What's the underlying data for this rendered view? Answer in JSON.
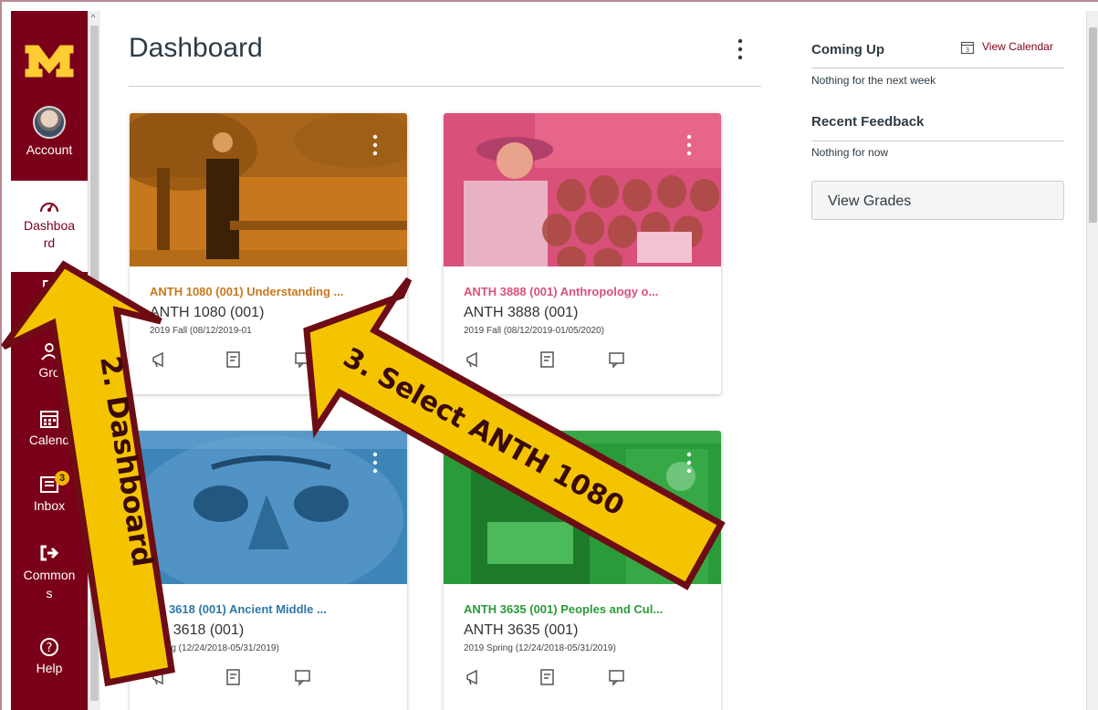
{
  "nav": {
    "account": "Account",
    "dashboard": "Dashboa rd",
    "groups": "Gro",
    "calendar": "Calend",
    "inbox": "Inbox",
    "inbox_badge": "3",
    "commons": "Common s",
    "help": "Help"
  },
  "page": {
    "title": "Dashboard"
  },
  "cards": [
    {
      "full_name": "ANTH 1080 (001) Understanding ...",
      "code": "ANTH 1080 (001)",
      "term": "2019 Fall (08/12/2019-01",
      "color": "#c8781c"
    },
    {
      "full_name": "ANTH 3888 (001) Anthropology o...",
      "code": "ANTH 3888 (001)",
      "term": "2019 Fall (08/12/2019-01/05/2020)",
      "color": "#d9517a"
    },
    {
      "full_name": "TH 3618 (001) Ancient Middle ...",
      "code": "TH 3618 (001)",
      "term": "Spring (12/24/2018-05/31/2019)",
      "color": "#2f77a6"
    },
    {
      "full_name": "ANTH 3635 (001) Peoples and Cul...",
      "code": "ANTH 3635 (001)",
      "term": "2019 Spring (12/24/2018-05/31/2019)",
      "color": "#2a9b39"
    }
  ],
  "sidebar": {
    "coming_up": "Coming Up",
    "view_calendar": "View Calendar",
    "coming_up_empty": "Nothing for the next week",
    "recent_feedback": "Recent Feedback",
    "feedback_empty": "Nothing for now",
    "view_grades": "View Grades"
  },
  "annotations": {
    "arrow2": "2. Dashboard",
    "arrow3": "3. Select ANTH 1080"
  },
  "colors": {
    "brand": "#7a0019",
    "arrow_fill": "#f5c400",
    "arrow_stroke": "#6d0c14"
  },
  "icons": [
    "announcement-icon",
    "assignment-icon",
    "discussion-icon",
    "kebab-menu-icon",
    "calendar-icon",
    "dashboard-icon",
    "groups-icon",
    "inbox-icon",
    "commons-icon",
    "help-icon"
  ]
}
